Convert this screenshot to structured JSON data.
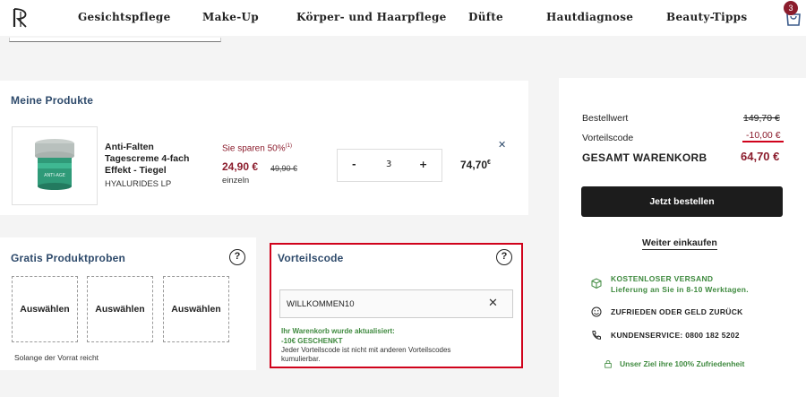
{
  "nav": {
    "items": [
      "Gesichtspflege",
      "Make-Up",
      "Körper- und Haarpflege",
      "Düfte",
      "Hautdiagnose",
      "Beauty-Tipps"
    ],
    "cart_count": "3"
  },
  "colors": {
    "accent_red": "#8b1c2c",
    "title_blue": "#2e4a6b",
    "promo_green": "#3f8a3f",
    "highlight_red": "#d0021b",
    "button_dark": "#1c1c1c"
  },
  "products": {
    "title": "Meine Produkte",
    "item": {
      "name": "Anti-Falten Tagescreme 4-fach Effekt - Tiegel",
      "subtitle": "HYALURIDES LP",
      "savings_label": "Sie sparen 50%",
      "savings_sup": "(1)",
      "price": "24,90 €",
      "old_price": "49,90 €",
      "unit": "einzeln",
      "qty_minus": "-",
      "quantity": "3",
      "qty_plus": "+",
      "total": "74,70",
      "total_sup": "€",
      "remove": "✕"
    }
  },
  "samples": {
    "title": "Gratis Produktproben",
    "help": "?",
    "options": [
      "Auswählen",
      "Auswählen",
      "Auswählen"
    ],
    "note": "Solange der Vorrat reicht"
  },
  "voucher": {
    "title": "Vorteilscode",
    "help": "?",
    "code_value": "WILLKOMMEN10",
    "clear": "✕",
    "updated_msg": "Ihr Warenkorb wurde aktualisiert:",
    "gift_msg": "-10€ GESCHENKT",
    "note_line1": "Jeder Vorteilscode ist nicht mit anderen Vorteilscodes",
    "note_line2": "kumulierbar."
  },
  "summary": {
    "order_value_label": "Bestellwert",
    "order_value": "149,70 €",
    "voucher_label": "Vorteilscode",
    "voucher_value": "-10,00 €",
    "total_label": "GESAMT WARENKORB",
    "total_value": "64,70 €",
    "order_button": "Jetzt bestellen",
    "continue_link": "Weiter einkaufen"
  },
  "features": {
    "shipping_title": "KOSTENLOSER VERSAND",
    "shipping_sub": "Lieferung an Sie in 8-10 Werktagen.",
    "satisfaction": "ZUFRIEDEN ODER GELD ZURÜCK",
    "service": "KUNDENSERVICE: 0800 182 5202",
    "guarantee": "Unser Ziel ihre 100% Zufriedenheit"
  }
}
